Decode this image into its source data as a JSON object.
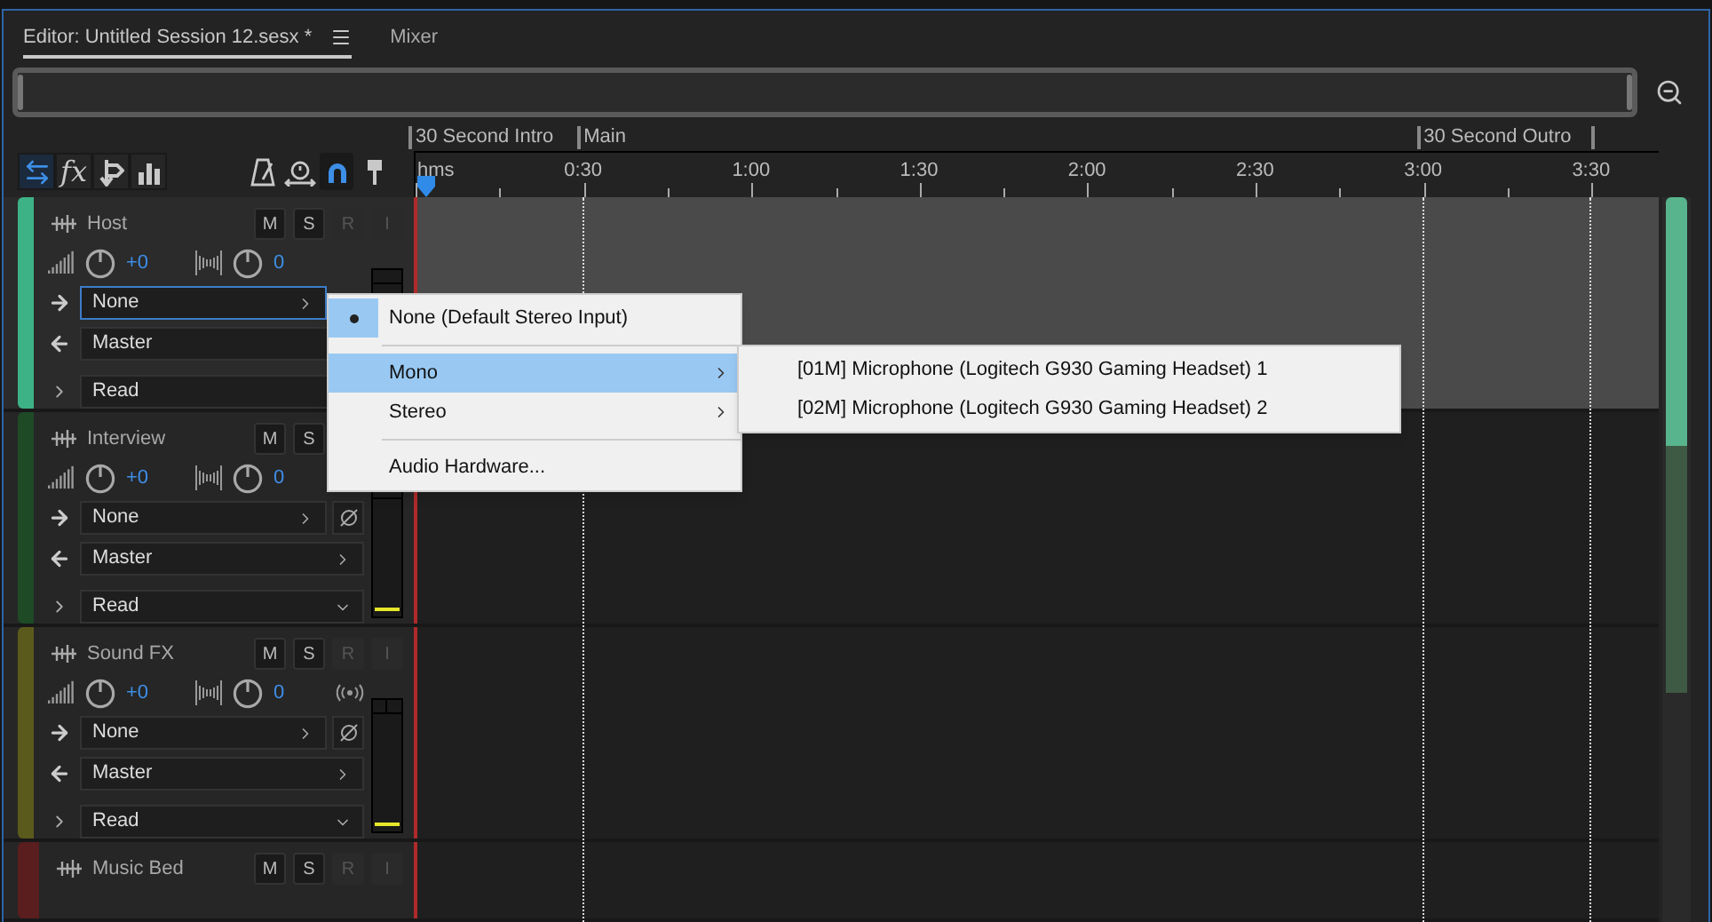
{
  "tabs": [
    {
      "label": "Editor: Untitled Session 12.sesx *",
      "selected": true,
      "has_menu": true
    },
    {
      "label": "Mixer",
      "selected": false,
      "has_menu": false
    }
  ],
  "tools": [
    {
      "kind": "io",
      "selected": true
    },
    {
      "kind": "fx",
      "label": "fx",
      "selected": false
    },
    {
      "kind": "sends",
      "selected": false
    },
    {
      "kind": "eq",
      "selected": false
    },
    {
      "kind": "metronome",
      "selected": false
    },
    {
      "kind": "timer",
      "selected": false
    },
    {
      "kind": "snap",
      "selected": true
    },
    {
      "kind": "marker",
      "selected": false
    }
  ],
  "markers": [
    {
      "label": "30 Second Intro"
    },
    {
      "label": "Main"
    },
    {
      "label": "30 Second Outro"
    }
  ],
  "ruler": {
    "labels": [
      "hms",
      "0:30",
      "1:00",
      "1:30",
      "2:00",
      "2:30",
      "3:00",
      "3:30"
    ]
  },
  "tracks": [
    {
      "name": "Host",
      "color": "#3db287",
      "selected": true,
      "volume": "+0",
      "pan": "0",
      "input": "None",
      "input_focused": true,
      "output": "Master",
      "automation": "Read",
      "buttons": [
        {
          "label": "M",
          "disabled": false
        },
        {
          "label": "S",
          "disabled": false
        },
        {
          "label": "R",
          "disabled": true
        },
        {
          "label": "I",
          "disabled": true
        }
      ]
    },
    {
      "name": "Interview",
      "color": "#1e4a26",
      "selected": false,
      "volume": "+0",
      "pan": "0",
      "input": "None",
      "input_focused": false,
      "output": "Master",
      "automation": "Read",
      "buttons": [
        {
          "label": "M",
          "disabled": false
        },
        {
          "label": "S",
          "disabled": false
        }
      ]
    },
    {
      "name": "Sound FX",
      "color": "#5b5a1d",
      "selected": false,
      "volume": "+0",
      "pan": "0",
      "input": "None",
      "input_focused": false,
      "output": "Master",
      "automation": "Read",
      "monitor": true,
      "buttons": [
        {
          "label": "M",
          "disabled": false
        },
        {
          "label": "S",
          "disabled": false
        },
        {
          "label": "R",
          "disabled": true
        },
        {
          "label": "I",
          "disabled": true
        }
      ]
    },
    {
      "name": "Music Bed",
      "color": "#5a1e1e",
      "selected": false,
      "buttons": [
        {
          "label": "M",
          "disabled": false
        },
        {
          "label": "S",
          "disabled": false
        },
        {
          "label": "R",
          "disabled": true
        },
        {
          "label": "I",
          "disabled": true
        }
      ]
    }
  ],
  "menu": {
    "items": [
      {
        "kind": "item",
        "label": "None (Default Stereo Input)",
        "checked": true,
        "selected": false,
        "submenu": false
      },
      {
        "kind": "separator"
      },
      {
        "kind": "item",
        "label": "Mono",
        "checked": false,
        "selected": true,
        "submenu": true
      },
      {
        "kind": "item",
        "label": "Stereo",
        "checked": false,
        "selected": false,
        "submenu": true
      },
      {
        "kind": "separator"
      },
      {
        "kind": "item",
        "label": "Audio Hardware...",
        "checked": false,
        "selected": false,
        "submenu": false
      }
    ],
    "submenu": [
      {
        "label": "[01M] Microphone (Logitech G930 Gaming Headset) 1",
        "selected": false
      },
      {
        "label": "[02M] Microphone (Logitech G930 Gaming Headset) 2",
        "selected": false
      }
    ]
  }
}
